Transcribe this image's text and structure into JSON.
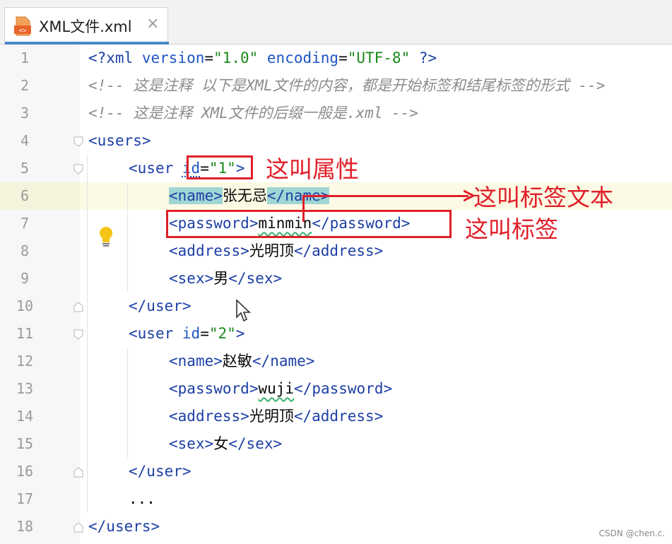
{
  "tab": {
    "title": "XML文件.xml",
    "close_glyph": "×",
    "icon": "xml-file-icon",
    "accent_color": "#4a88c7"
  },
  "editor": {
    "line_numbers": [
      "1",
      "2",
      "3",
      "4",
      "5",
      "6",
      "7",
      "8",
      "9",
      "10",
      "11",
      "12",
      "13",
      "14",
      "15",
      "16",
      "17",
      "18"
    ],
    "current_line": "6",
    "lines": {
      "l1": {
        "p1": "<?xml ",
        "p2": "version",
        "p3": "=",
        "p4": "\"1.0\"",
        "p5": " ",
        "p6": "encoding",
        "p7": "=",
        "p8": "\"UTF-8\"",
        "p9": " ?>"
      },
      "l2": {
        "c": "<!-- 这是注释 以下是XML文件的内容，都是开始标签和结尾标签的形式 -->"
      },
      "l3": {
        "c": "<!-- 这是注释 XML文件的后缀一般是.xml -->"
      },
      "l4": {
        "open": "<",
        "name": "users",
        "close": ">"
      },
      "l5": {
        "open": "<",
        "name": "user",
        "sp": " ",
        "attr": "id",
        "eq": "=",
        "val": "\"1\"",
        "close": ">"
      },
      "l6": {
        "o1": "<",
        "n1": "name",
        "c1": ">",
        "text": "张无忌",
        "o2": "</",
        "n2": "name",
        "c2": ">"
      },
      "l7": {
        "o1": "<",
        "n1": "password",
        "c1": ">",
        "text": "minmin",
        "o2": "</",
        "n2": "password",
        "c2": ">"
      },
      "l8": {
        "o1": "<",
        "n1": "address",
        "c1": ">",
        "text": "光明顶",
        "o2": "</",
        "n2": "address",
        "c2": ">"
      },
      "l9": {
        "o1": "<",
        "n1": "sex",
        "c1": ">",
        "text": "男",
        "o2": "</",
        "n2": "sex",
        "c2": ">"
      },
      "l10": {
        "o": "</",
        "n": "user",
        "c": ">"
      },
      "l11": {
        "open": "<",
        "name": "user",
        "sp": " ",
        "attr": "id",
        "eq": "=",
        "val": "\"2\"",
        "close": ">"
      },
      "l12": {
        "o1": "<",
        "n1": "name",
        "c1": ">",
        "text": "赵敏",
        "o2": "</",
        "n2": "name",
        "c2": ">"
      },
      "l13": {
        "o1": "<",
        "n1": "password",
        "c1": ">",
        "text": "wuji",
        "o2": "</",
        "n2": "password",
        "c2": ">"
      },
      "l14": {
        "o1": "<",
        "n1": "address",
        "c1": ">",
        "text": "光明顶",
        "o2": "</",
        "n2": "address",
        "c2": ">"
      },
      "l15": {
        "o1": "<",
        "n1": "sex",
        "c1": ">",
        "text": "女",
        "o2": "</",
        "n2": "sex",
        "c2": ">"
      },
      "l16": {
        "o": "</",
        "n": "user",
        "c": ">"
      },
      "l17": {
        "t": "..."
      },
      "l18": {
        "o": "</",
        "n": "users",
        "c": ">"
      }
    }
  },
  "annotations": {
    "attribute_label": "这叫属性",
    "tag_text_label": "这叫标签文本",
    "tag_label": "这叫标签",
    "color": "#e0202a"
  },
  "watermark": "CSDN @chen.c."
}
